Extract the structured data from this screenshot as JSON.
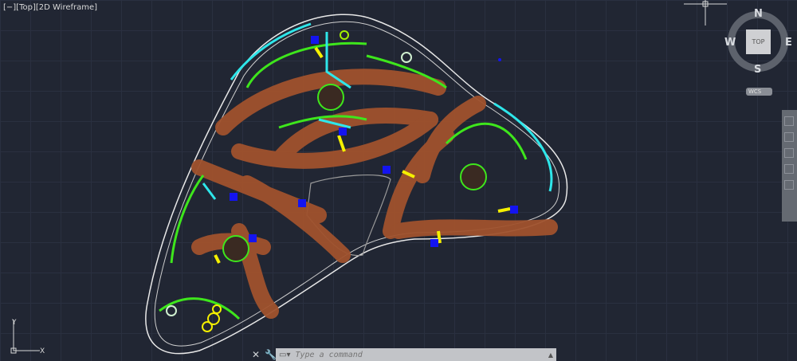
{
  "viewport": {
    "label": "[−][Top][2D Wireframe]"
  },
  "viewcube": {
    "north": "N",
    "south": "S",
    "east": "E",
    "west": "W",
    "face": "TOP",
    "coord_system": "WCS"
  },
  "ucs": {
    "x": "X",
    "y": "Y"
  },
  "command": {
    "placeholder": "Type a command"
  },
  "colors": {
    "background": "#212633",
    "brown": "#a0522d",
    "green": "#3ee61c",
    "cyan": "#2ee6ea",
    "yellow": "#f5f000",
    "blue": "#1414f0"
  }
}
